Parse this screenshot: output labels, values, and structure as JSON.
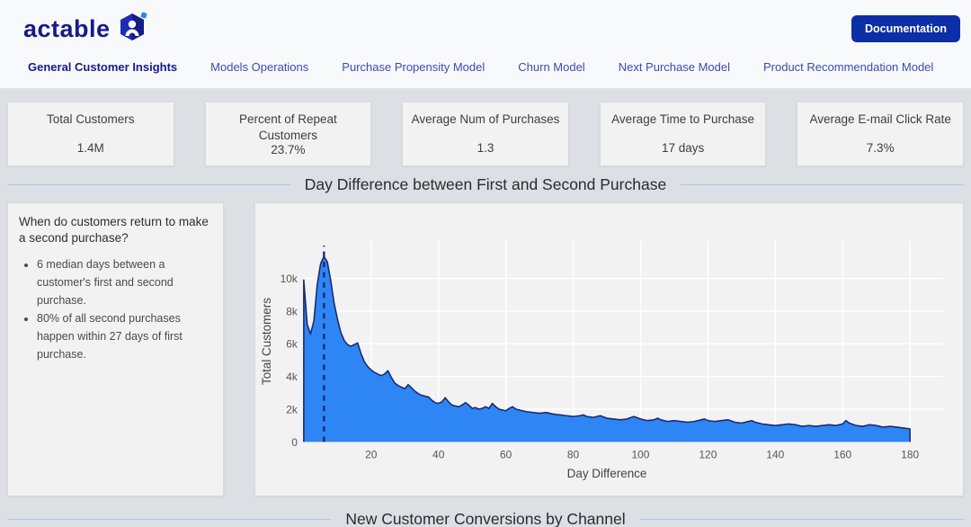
{
  "header": {
    "logo_text": "actable",
    "documentation_button": "Documentation",
    "nav": [
      {
        "label": "General Customer Insights",
        "active": true
      },
      {
        "label": "Models Operations",
        "active": false
      },
      {
        "label": "Purchase Propensity Model",
        "active": false
      },
      {
        "label": "Churn Model",
        "active": false
      },
      {
        "label": "Next Purchase Model",
        "active": false
      },
      {
        "label": "Product Recommendation Model",
        "active": false
      }
    ]
  },
  "kpis": [
    {
      "title": "Total Customers",
      "value": "1.4M"
    },
    {
      "title": "Percent of Repeat Customers",
      "value": "23.7%"
    },
    {
      "title": "Average Num of Purchases",
      "value": "1.3"
    },
    {
      "title": "Average Time to Purchase",
      "value": "17 days"
    },
    {
      "title": "Average E-mail Click Rate",
      "value": "7.3%"
    }
  ],
  "section": {
    "title": "Day Difference between First and Second Purchase"
  },
  "insight_panel": {
    "question": "When do customers return to make a second purchase?",
    "bullets": [
      "6 median days between a customer's first and second purchase.",
      "80% of all second purchases happen within 27 days of first purchase."
    ]
  },
  "bottom_section": {
    "title": "New Customer Conversions by Channel"
  },
  "colors": {
    "brand_navy": "#171b87",
    "nav_inactive": "#3c4bb0",
    "doc_button": "#0c2ea6",
    "section_line": "#a9c4f0",
    "chart_fill": "#2e86f5",
    "chart_stroke": "#1c2a70",
    "gridline": "#ffffff",
    "tick_text": "#555555",
    "panel_bg": "#f2f2f3",
    "page_bg": "#dcdfe4"
  },
  "chart_data": {
    "type": "area",
    "title": "Day Difference between First and Second Purchase",
    "xlabel": "Day Difference",
    "ylabel": "Total Customers",
    "xlim": [
      0,
      180
    ],
    "ylim": [
      0,
      12300
    ],
    "x_ticks": [
      20,
      40,
      60,
      80,
      100,
      120,
      140,
      160,
      180
    ],
    "y_ticks": [
      0,
      2000,
      4000,
      6000,
      8000,
      10000
    ],
    "y_tick_labels": [
      "0",
      "2k",
      "4k",
      "6k",
      "8k",
      "10k"
    ],
    "grid": true,
    "legend": "none",
    "median_day": 6,
    "points": [
      [
        0,
        9900
      ],
      [
        1,
        7200
      ],
      [
        2,
        6600
      ],
      [
        3,
        7400
      ],
      [
        4,
        9600
      ],
      [
        5,
        10900
      ],
      [
        6,
        11350
      ],
      [
        7,
        11000
      ],
      [
        8,
        9900
      ],
      [
        9,
        8500
      ],
      [
        10,
        7500
      ],
      [
        11,
        6700
      ],
      [
        12,
        6200
      ],
      [
        13,
        5950
      ],
      [
        14,
        5850
      ],
      [
        15,
        5950
      ],
      [
        16,
        6050
      ],
      [
        17,
        5400
      ],
      [
        18,
        4900
      ],
      [
        19,
        4600
      ],
      [
        20,
        4400
      ],
      [
        21,
        4250
      ],
      [
        22,
        4150
      ],
      [
        23,
        4050
      ],
      [
        24,
        4150
      ],
      [
        25,
        4350
      ],
      [
        26,
        3950
      ],
      [
        27,
        3600
      ],
      [
        28,
        3450
      ],
      [
        29,
        3350
      ],
      [
        30,
        3250
      ],
      [
        31,
        3500
      ],
      [
        32,
        3300
      ],
      [
        33,
        3100
      ],
      [
        34,
        2950
      ],
      [
        35,
        2850
      ],
      [
        36,
        2800
      ],
      [
        37,
        2750
      ],
      [
        38,
        2550
      ],
      [
        39,
        2400
      ],
      [
        40,
        2350
      ],
      [
        41,
        2450
      ],
      [
        42,
        2700
      ],
      [
        43,
        2450
      ],
      [
        44,
        2250
      ],
      [
        45,
        2200
      ],
      [
        46,
        2150
      ],
      [
        47,
        2250
      ],
      [
        48,
        2400
      ],
      [
        49,
        2250
      ],
      [
        50,
        2050
      ],
      [
        51,
        2100
      ],
      [
        52,
        2000
      ],
      [
        53,
        2050
      ],
      [
        54,
        2150
      ],
      [
        55,
        2050
      ],
      [
        56,
        2350
      ],
      [
        57,
        2150
      ],
      [
        58,
        2000
      ],
      [
        59,
        1950
      ],
      [
        60,
        1900
      ],
      [
        61,
        2050
      ],
      [
        62,
        2150
      ],
      [
        63,
        2000
      ],
      [
        64,
        1950
      ],
      [
        66,
        1850
      ],
      [
        68,
        1800
      ],
      [
        70,
        1750
      ],
      [
        72,
        1800
      ],
      [
        74,
        1700
      ],
      [
        76,
        1650
      ],
      [
        78,
        1600
      ],
      [
        80,
        1550
      ],
      [
        82,
        1600
      ],
      [
        83,
        1650
      ],
      [
        84,
        1550
      ],
      [
        86,
        1500
      ],
      [
        88,
        1600
      ],
      [
        90,
        1450
      ],
      [
        92,
        1400
      ],
      [
        94,
        1350
      ],
      [
        96,
        1400
      ],
      [
        98,
        1550
      ],
      [
        100,
        1400
      ],
      [
        102,
        1300
      ],
      [
        104,
        1350
      ],
      [
        105,
        1450
      ],
      [
        106,
        1350
      ],
      [
        108,
        1250
      ],
      [
        110,
        1300
      ],
      [
        112,
        1250
      ],
      [
        114,
        1200
      ],
      [
        116,
        1250
      ],
      [
        118,
        1350
      ],
      [
        119,
        1400
      ],
      [
        120,
        1300
      ],
      [
        122,
        1250
      ],
      [
        124,
        1300
      ],
      [
        126,
        1350
      ],
      [
        128,
        1200
      ],
      [
        130,
        1150
      ],
      [
        132,
        1250
      ],
      [
        133,
        1300
      ],
      [
        134,
        1200
      ],
      [
        136,
        1100
      ],
      [
        138,
        1050
      ],
      [
        140,
        1000
      ],
      [
        142,
        1050
      ],
      [
        144,
        1100
      ],
      [
        146,
        1050
      ],
      [
        148,
        950
      ],
      [
        150,
        1000
      ],
      [
        152,
        950
      ],
      [
        154,
        1000
      ],
      [
        156,
        1050
      ],
      [
        158,
        1000
      ],
      [
        160,
        1100
      ],
      [
        161,
        1300
      ],
      [
        162,
        1150
      ],
      [
        164,
        1000
      ],
      [
        166,
        950
      ],
      [
        168,
        1050
      ],
      [
        170,
        1000
      ],
      [
        172,
        900
      ],
      [
        174,
        950
      ],
      [
        176,
        900
      ],
      [
        178,
        850
      ],
      [
        180,
        800
      ]
    ]
  }
}
